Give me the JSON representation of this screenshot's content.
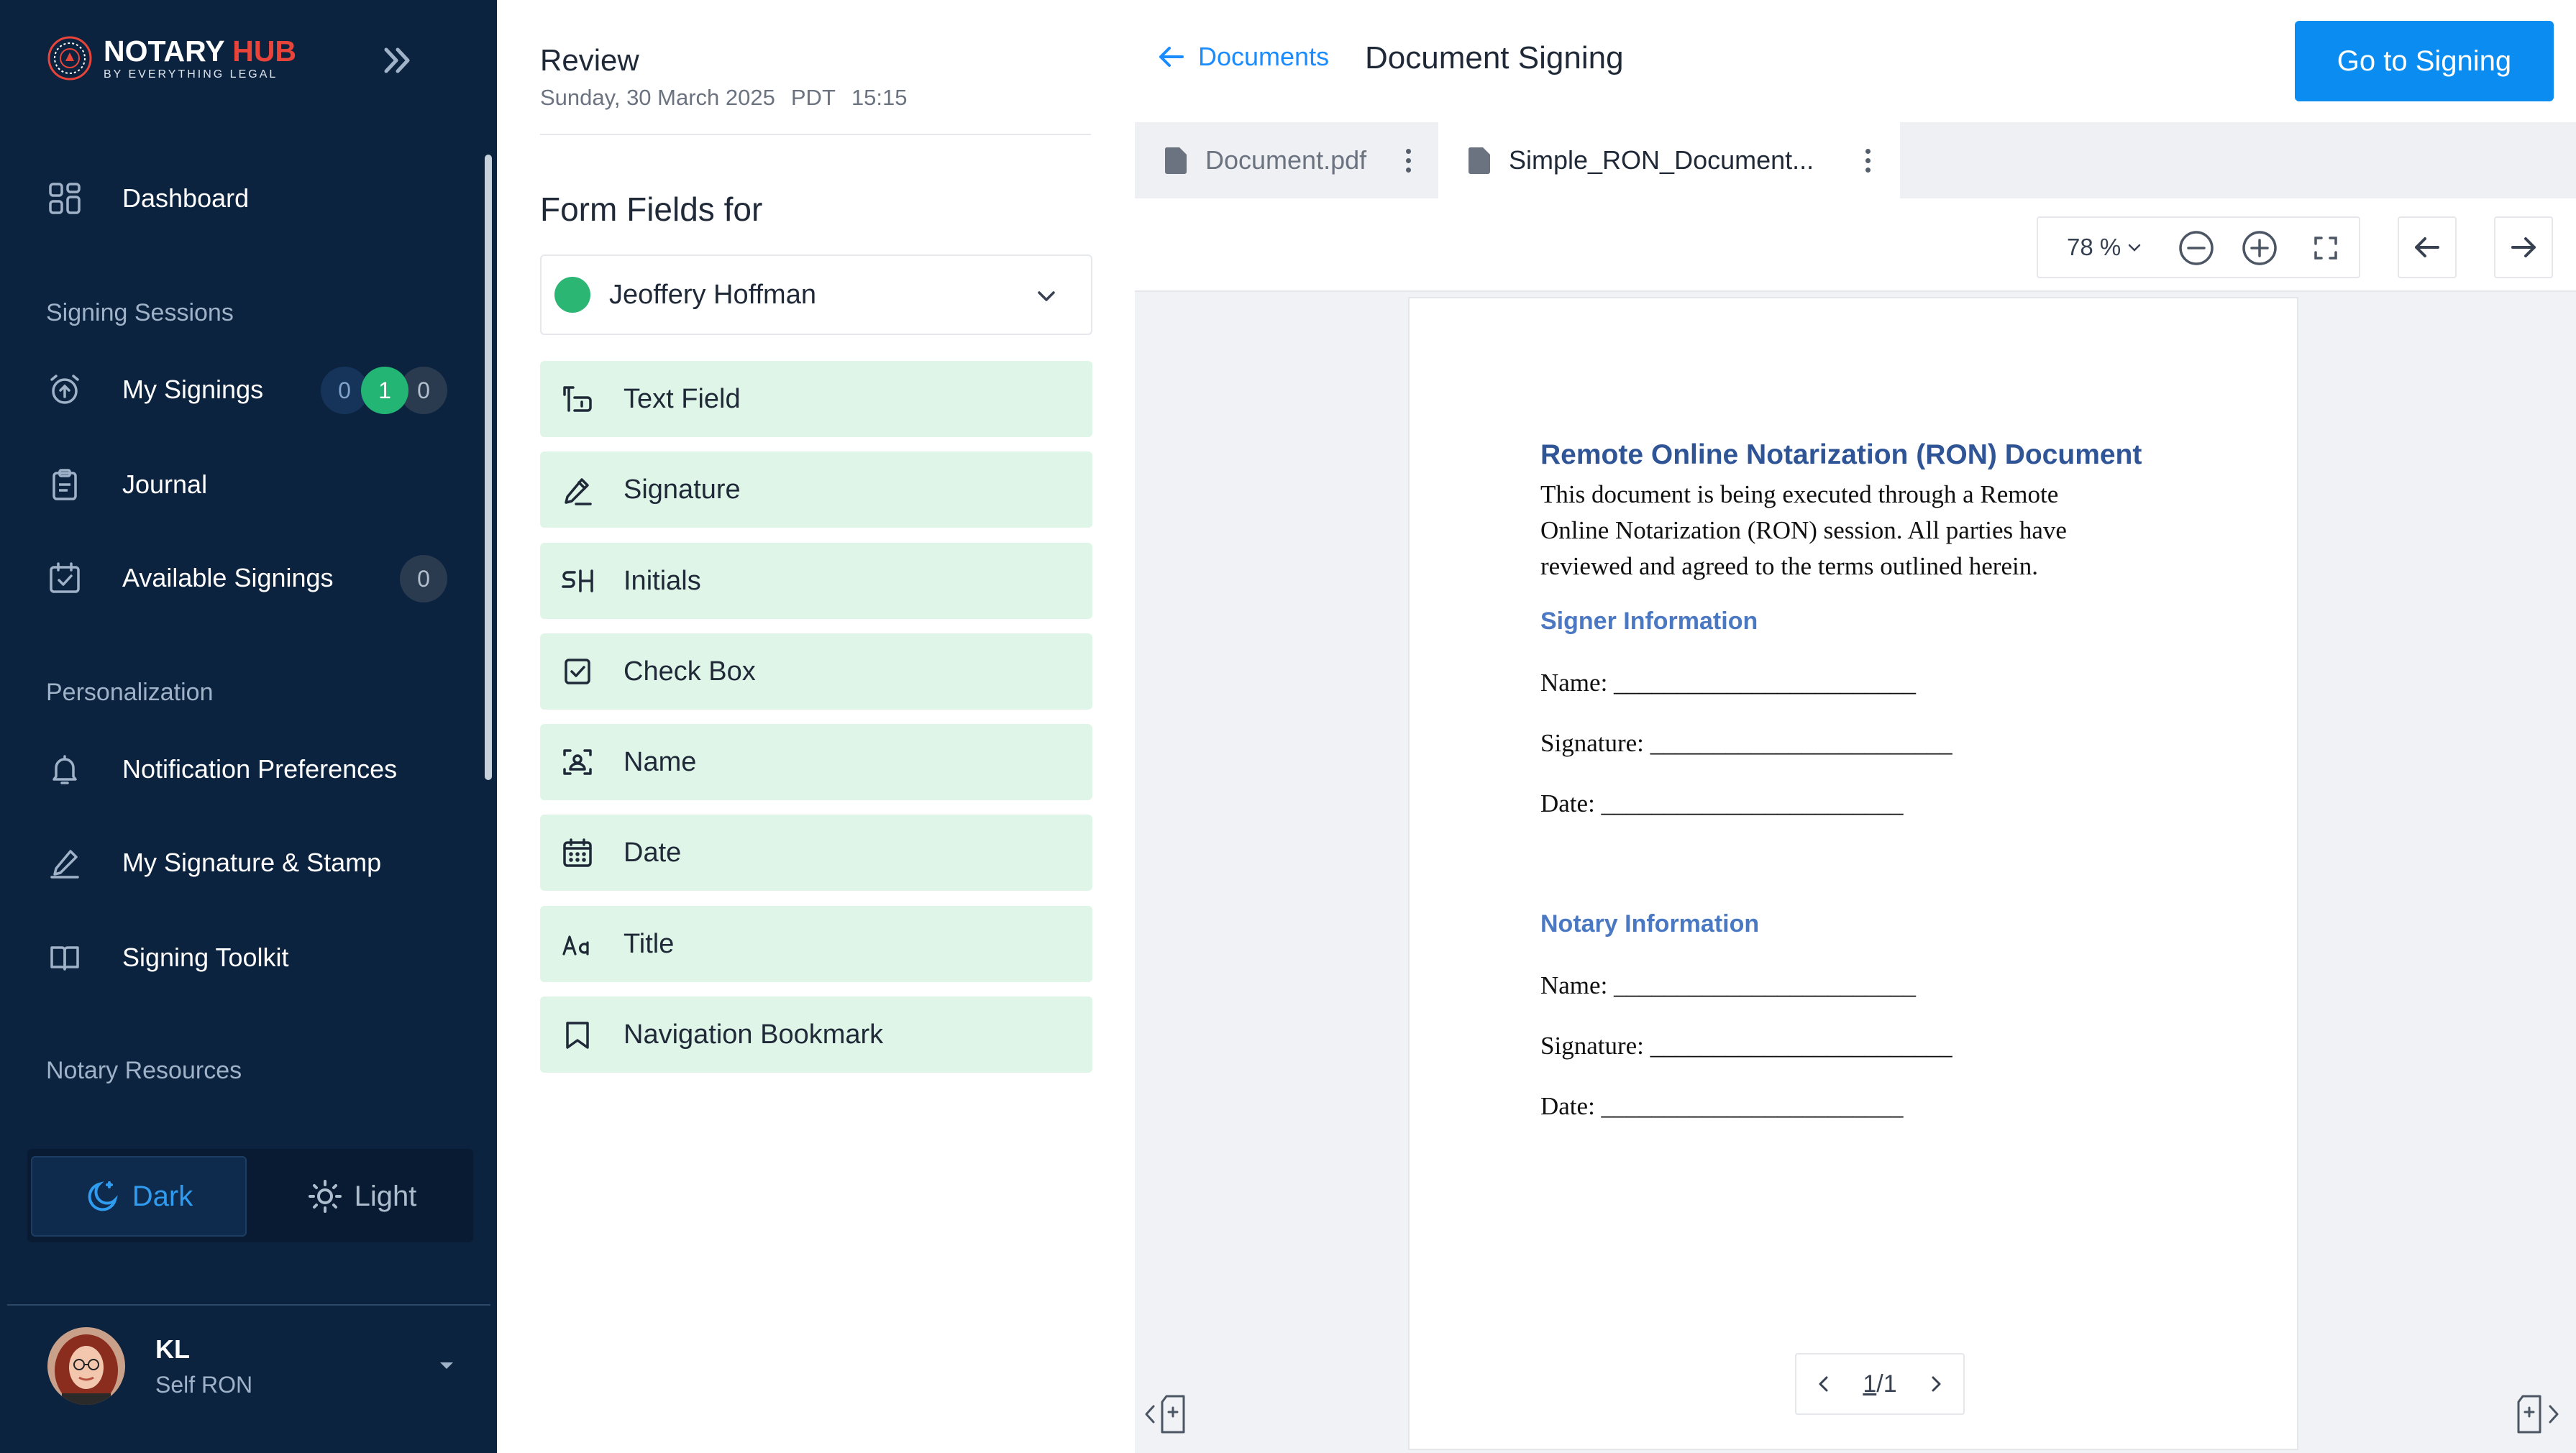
{
  "brand": {
    "name_a": "NOTARY",
    "name_b": "HUB",
    "tagline": "BY EVERYTHING LEGAL"
  },
  "colors": {
    "sidebar_bg": "#0c2340",
    "accent_blue": "#0a8cf0",
    "field_bg": "#dff5e8",
    "green": "#2bb673",
    "brand_red": "#e8443a"
  },
  "sidebar": {
    "dashboard": "Dashboard",
    "section_signing": "Signing Sessions",
    "my_signings": {
      "label": "My Signings",
      "counts": [
        "0",
        "1",
        "0"
      ]
    },
    "journal": "Journal",
    "available_signings": {
      "label": "Available Signings",
      "count": "0"
    },
    "section_personalization": "Personalization",
    "notification_prefs": "Notification Preferences",
    "signature_stamp": "My Signature & Stamp",
    "signing_toolkit": "Signing Toolkit",
    "section_resources": "Notary Resources",
    "theme": {
      "dark": "Dark",
      "light": "Light"
    },
    "user": {
      "initials": "KL",
      "role": "Self RON"
    }
  },
  "review": {
    "title": "Review",
    "date": "Sunday, 30 March 2025",
    "timezone": "PDT",
    "time": "15:15"
  },
  "form_fields": {
    "title": "Form Fields for",
    "signer": "Jeoffery Hoffman",
    "items": [
      {
        "label": "Text Field",
        "icon": "text-field-icon"
      },
      {
        "label": "Signature",
        "icon": "pen-icon"
      },
      {
        "label": "Initials",
        "icon": "initials-icon"
      },
      {
        "label": "Check Box",
        "icon": "checkbox-icon"
      },
      {
        "label": "Name",
        "icon": "name-badge-icon"
      },
      {
        "label": "Date",
        "icon": "calendar-icon"
      },
      {
        "label": "Title",
        "icon": "title-aa-icon"
      },
      {
        "label": "Navigation Bookmark",
        "icon": "bookmark-icon"
      }
    ]
  },
  "header": {
    "back_label": "Documents",
    "title": "Document Signing",
    "go_button": "Go to Signing"
  },
  "tabs": [
    {
      "label": "Document.pdf",
      "active": false
    },
    {
      "label": "Simple_RON_Document...",
      "active": true
    }
  ],
  "toolbar": {
    "zoom": "78 %"
  },
  "document": {
    "heading": "Remote Online Notarization (RON) Document",
    "intro_1": "This document is being executed through a Remote",
    "intro_2": "Online Notarization (RON) session. All parties have",
    "intro_3": "reviewed and agreed to the terms outlined herein.",
    "signer_section": "Signer Information",
    "signer_name": "Name: ________________________",
    "signer_signature": "Signature: ________________________",
    "signer_date": "Date: ________________________",
    "notary_section": "Notary Information",
    "notary_name": "Name: ________________________",
    "notary_signature": "Signature: ________________________",
    "notary_date": "Date: ________________________"
  },
  "pager": {
    "current": "1",
    "separator": "/",
    "total": "1"
  }
}
